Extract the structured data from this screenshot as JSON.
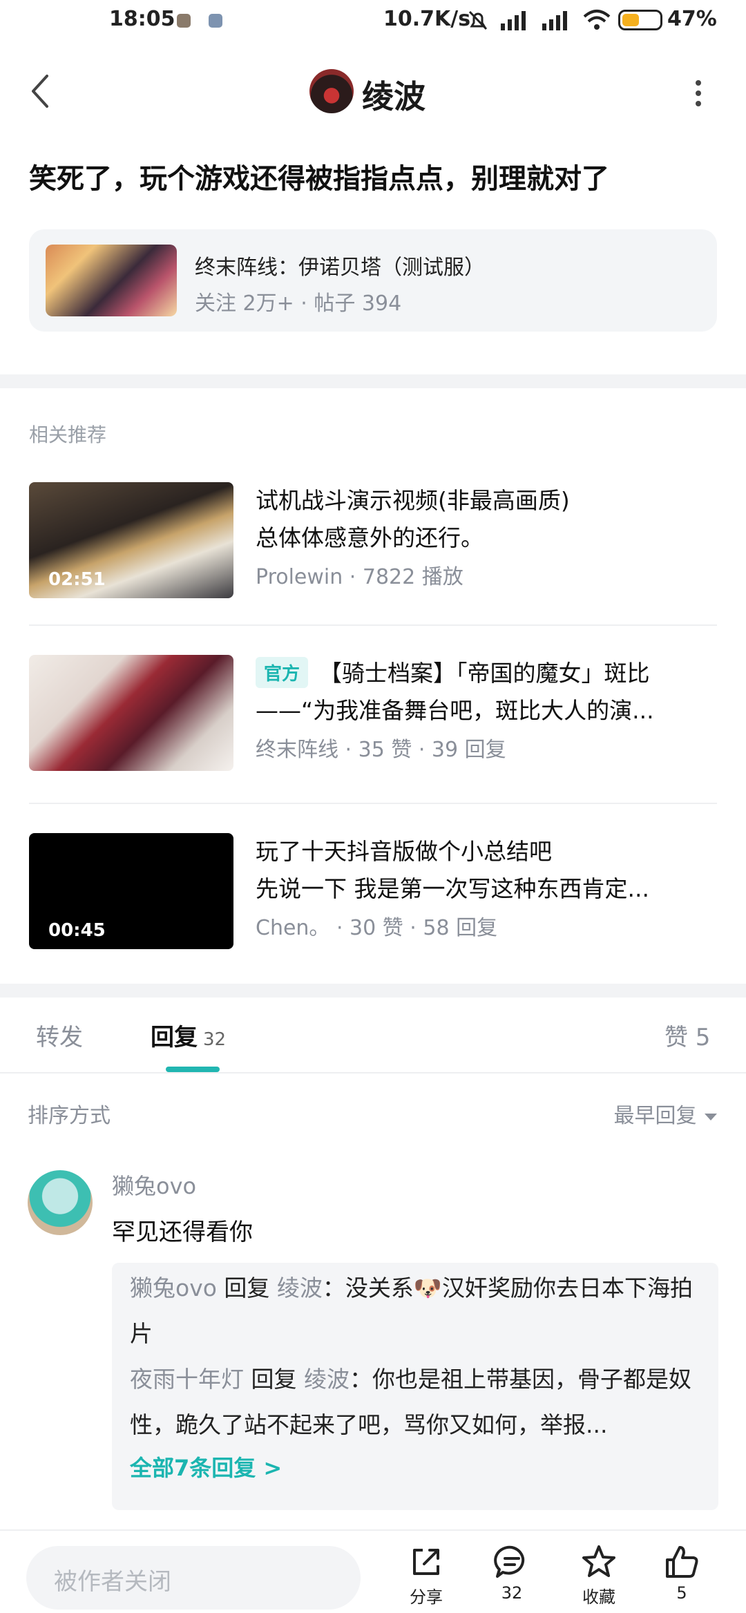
{
  "status_bar": {
    "time": "18:05",
    "net_speed": "10.7K/s",
    "battery": "47%",
    "battery_level": 0.47,
    "icons": [
      "notification-off-icon",
      "signal-icon",
      "signal-icon",
      "wifi-icon",
      "battery-icon"
    ]
  },
  "header": {
    "title": "绫波",
    "back_icon": "back-arrow-icon",
    "more_icon": "more-vertical-icon"
  },
  "post": {
    "title": "笑死了，玩个游戏还得被指指点点，别理就对了"
  },
  "forum": {
    "name": "终末阵线：伊诺贝塔（测试服）",
    "stats": "关注 2万+  ·  帖子 394"
  },
  "recommend": {
    "label": "相关推荐",
    "items": [
      {
        "line1": "试机战斗演示视频(非最高画质)",
        "line2": "总体体感意外的还行。",
        "meta": "Prolewin  ·  7822 播放",
        "duration": "02:51",
        "badge": ""
      },
      {
        "line1": "【骑士档案】「帝国的魔女」斑比",
        "line2": "——“为我准备舞台吧，斑比大人的演...",
        "meta": "终末阵线  ·  35 赞  ·  39 回复",
        "duration": "",
        "badge": "官方"
      },
      {
        "line1": "玩了十天抖音版做个小总结吧",
        "line2": "先说一下 我是第一次写这种东西肯定...",
        "meta": "Chen。  ·  30 赞  ·  58 回复",
        "duration": "00:45",
        "badge": ""
      }
    ]
  },
  "tabs": {
    "forward": "转发",
    "reply": "回复",
    "reply_count": "32",
    "like": "赞 5"
  },
  "sort": {
    "label": "排序方式",
    "value": "最早回复"
  },
  "comment": {
    "user": "獭兔ovo",
    "text": "罕见还得看你",
    "replies": [
      {
        "from": "獭兔ovo",
        "verb": "回复",
        "to": "绫波",
        "text": "：没关系🐶汉奸奖励你去日本下海拍片"
      },
      {
        "from": "夜雨十年灯",
        "verb": "回复",
        "to": "绫波",
        "text": "：你也是祖上带基因，骨子都是奴性，跪久了站不起来了吧，骂你又如何，举报..."
      }
    ],
    "all_replies": "全部7条回复 >"
  },
  "bottom_bar": {
    "input_placeholder": "被作者关闭",
    "share": "分享",
    "comment_count": "32",
    "favorite": "收藏",
    "like_count": "5"
  }
}
